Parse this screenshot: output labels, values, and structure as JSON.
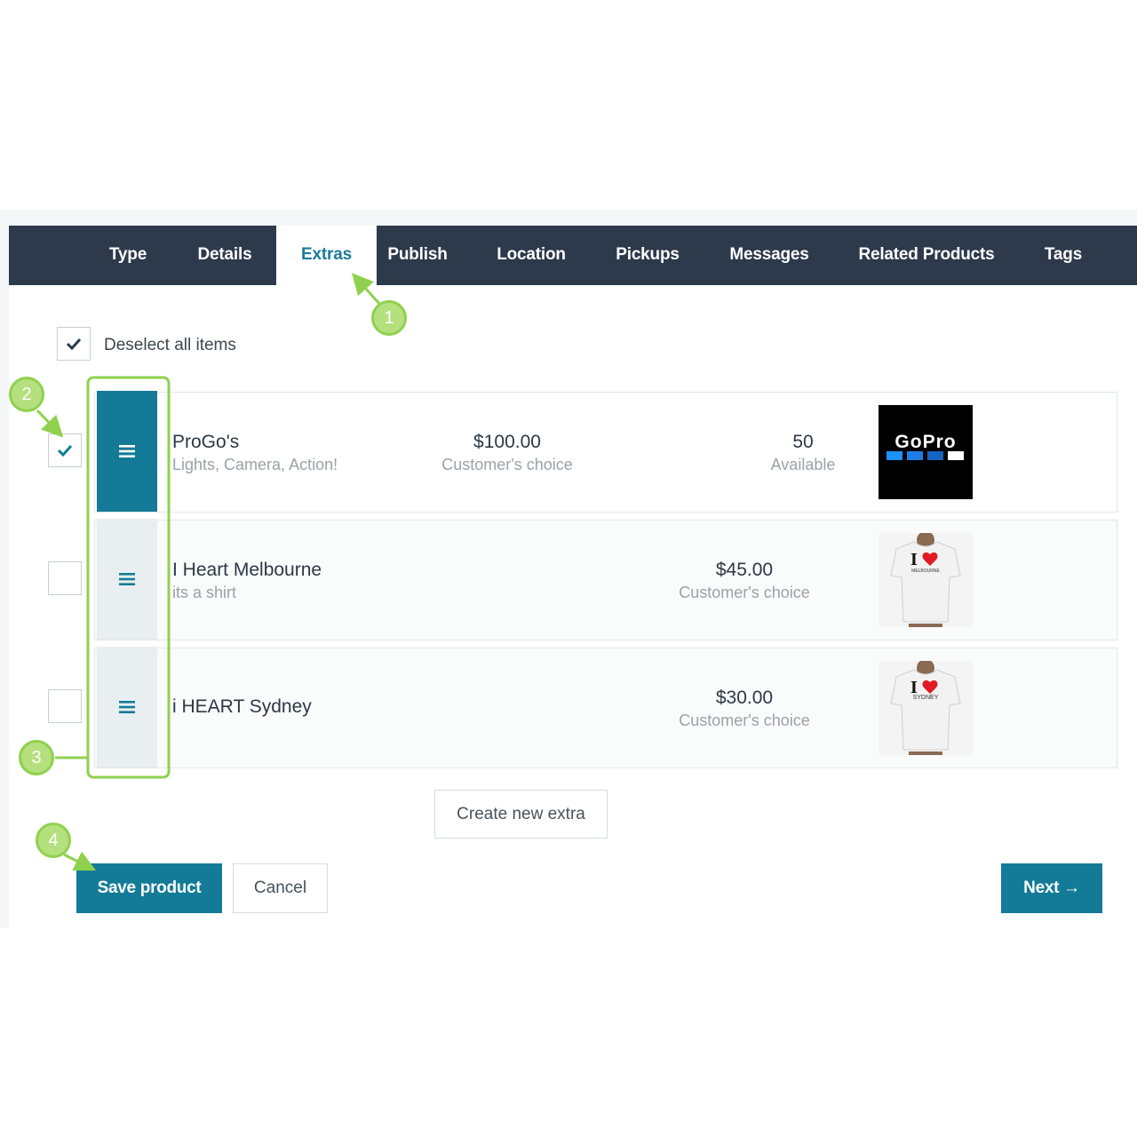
{
  "tabs": [
    "Type",
    "Details",
    "Extras",
    "Publish",
    "Location",
    "Pickups",
    "Messages",
    "Related Products",
    "Tags"
  ],
  "active_tab": "Extras",
  "select_all": {
    "label": "Deselect all items",
    "checked": true
  },
  "items": [
    {
      "title": "ProGo's",
      "subtitle": "Lights, Camera, Action!",
      "price": "$100.00",
      "price_note": "Customer's choice",
      "stock": "50",
      "stock_note": "Available",
      "checked": true,
      "image_icon": "gopro-logo-image",
      "image_text": "GoPro"
    },
    {
      "title": "I Heart Melbourne",
      "subtitle": "its a shirt",
      "price": "$45.00",
      "price_note": "Customer's choice",
      "checked": false,
      "image_icon": "tshirt-image",
      "image_text": "MELBOURNE"
    },
    {
      "title": "i HEART Sydney",
      "subtitle": "",
      "price": "$30.00",
      "price_note": "Customer's choice",
      "checked": false,
      "image_icon": "tshirt-image",
      "image_text": "SYDNEY"
    }
  ],
  "buttons": {
    "create_extra": "Create new extra",
    "save": "Save product",
    "cancel": "Cancel",
    "next": "Next →"
  },
  "callouts": [
    "1",
    "2",
    "3",
    "4"
  ],
  "colors": {
    "tabbar": "#2c3a4b",
    "accent": "#137b97",
    "callout": "#8fd14f"
  }
}
